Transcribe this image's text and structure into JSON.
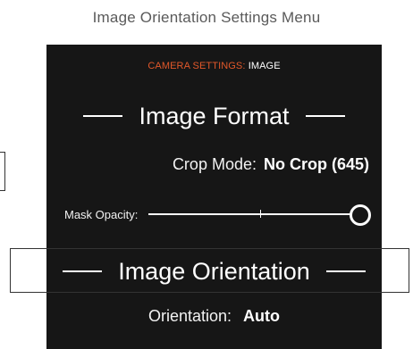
{
  "caption": "Image Orientation Settings Menu",
  "header": {
    "prefix": "CAMERA SETTINGS:",
    "title": "IMAGE"
  },
  "image_format": {
    "title": "Image Format",
    "crop_mode": {
      "label": "Crop Mode:",
      "value": "No Crop (645)"
    },
    "mask_opacity": {
      "label": "Mask Opacity:",
      "level": 1.0
    }
  },
  "image_orientation": {
    "title": "Image Orientation",
    "orientation": {
      "label": "Orientation:",
      "value": "Auto"
    }
  },
  "colors": {
    "background": "#161616",
    "accent": "#e2582a",
    "text": "#ffffff"
  }
}
